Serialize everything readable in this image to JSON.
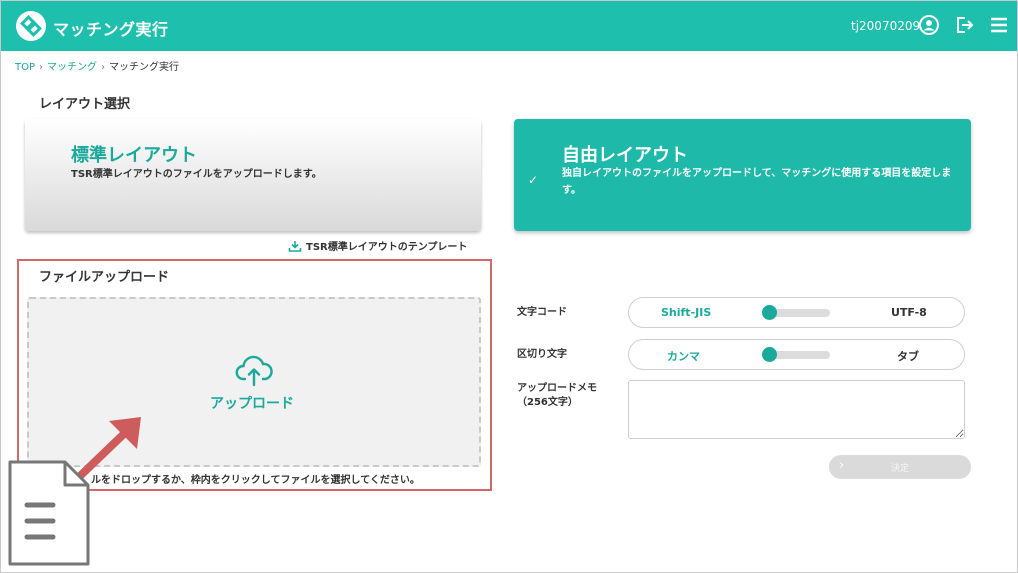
{
  "header": {
    "title": "マッチング実行",
    "user_id": "tj20070209",
    "colors": {
      "brand": "#1fbfae"
    }
  },
  "breadcrumb": {
    "items": [
      "TOP",
      "マッチング",
      "マッチング実行"
    ],
    "separator": "›"
  },
  "layout_select": {
    "heading": "レイアウト選択",
    "standard": {
      "title": "標準レイアウト",
      "description": "TSR標準レイアウトのファイルをアップロードします。"
    },
    "free": {
      "title": "自由レイアウト",
      "description": "独自レイアウトのファイルをアップロードして、マッチングに使用する項目を設定します。",
      "selected": true
    },
    "template_link": "TSR標準レイアウトのテンプレート"
  },
  "file_upload": {
    "heading": "ファイルアップロード",
    "upload_label": "アップロード",
    "hint": "ルをドロップするか、枠内をクリックしてファイルを選択してください。"
  },
  "form": {
    "charset": {
      "label": "文字コード",
      "left": "Shift-JIS",
      "right": "UTF-8"
    },
    "delimiter": {
      "label": "区切り文字",
      "left": "カンマ",
      "right": "タブ"
    },
    "memo": {
      "label_line1": "アップロードメモ",
      "label_line2": "（256文字）",
      "value": ""
    },
    "submit_label": "決定"
  }
}
